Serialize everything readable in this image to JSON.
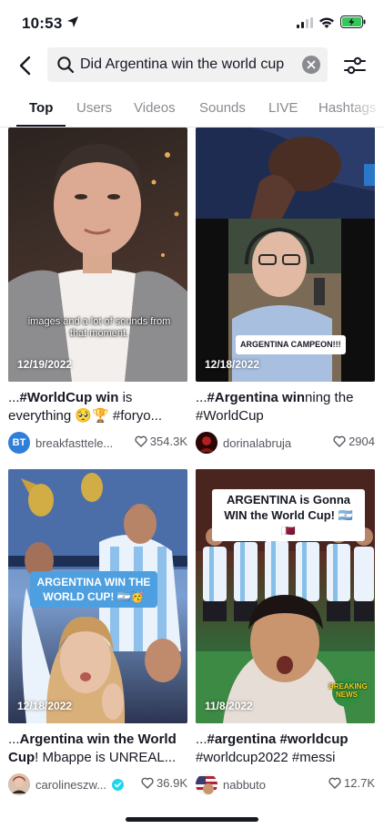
{
  "status": {
    "time": "10:53"
  },
  "search": {
    "query": "Did Argentina win the world cup"
  },
  "tabs": [
    {
      "label": "Top"
    },
    {
      "label": "Users"
    },
    {
      "label": "Videos"
    },
    {
      "label": "Sounds"
    },
    {
      "label": "LIVE"
    },
    {
      "label": "Hashtags"
    }
  ],
  "videos": [
    {
      "date": "12/19/2022",
      "caption_overlay": "images and a lot of sounds from that moment.",
      "title_prefix": "...",
      "title_bold": "#WorldCup win",
      "title_rest": " is everything 🥺🏆 #foryo...",
      "author": "breakfasttele...",
      "avatar_text": "BT",
      "likes": "354.3K"
    },
    {
      "date": "12/18/2022",
      "caption_overlay": "ARGENTINA CAMPEON!!!",
      "title_prefix": "...",
      "title_bold": "#Argentina win",
      "title_rest": "ning the #WorldCup",
      "author": "dorinalabruja",
      "avatar_text": "",
      "likes": "2904"
    },
    {
      "date": "12/18/2022",
      "caption_overlay": "ARGENTINA WIN THE WORLD CUP! 🇦🇷🥳",
      "title_prefix": "...",
      "title_bold": "Argentina win the World Cup",
      "title_rest": "! Mbappe is UNREAL...",
      "author": "carolineszw...",
      "avatar_text": "",
      "likes": "36.9K"
    },
    {
      "date": "11/8/2022",
      "caption_overlay": "ARGENTINA is Gonna WIN the World Cup! 🇦🇷🇶🇦",
      "badge_overlay": "BREAKING NEWS",
      "title_prefix": "...",
      "title_bold": "#argentina #worldcup",
      "title_rest": " #worldcup2022 #messi",
      "author": "nabbuto",
      "avatar_text": "",
      "likes": "12.7K"
    }
  ],
  "colors": {
    "accent_blue": "#4d9fe0",
    "text_primary": "#161823",
    "text_secondary": "#8a8b91",
    "search_bg": "#f1f1f2",
    "battery_green": "#34c759"
  }
}
